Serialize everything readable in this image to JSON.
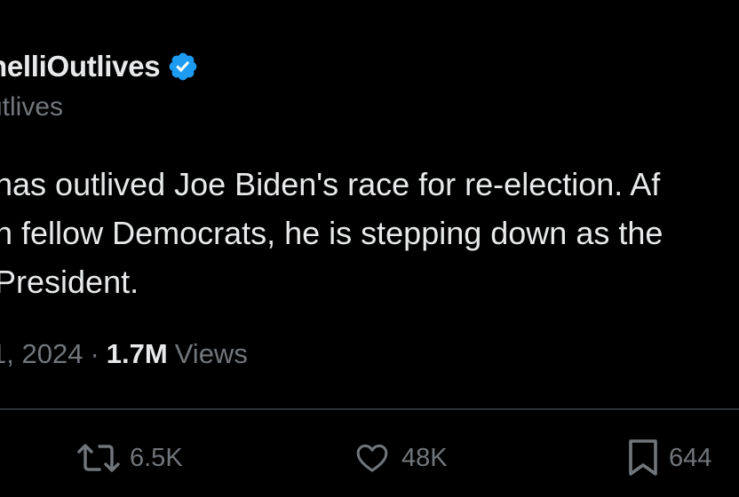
{
  "author": {
    "display_name": "nelliOutlives",
    "handle": "utlives",
    "verified_icon": "verified-badge-icon",
    "verified_color": "#1d9bf0"
  },
  "tweet": {
    "lines": [
      "has outlived Joe Biden's race for re-election. Af",
      "n fellow Democrats, he is stepping down as the",
      "President."
    ]
  },
  "meta": {
    "date": "1, 2024",
    "separator": "·",
    "views_count": "1.7M",
    "views_label": "Views"
  },
  "actions": {
    "retweet": {
      "icon": "retweet-icon",
      "count": "6.5K"
    },
    "like": {
      "icon": "heart-icon",
      "count": "48K"
    },
    "bookmark": {
      "icon": "bookmark-icon",
      "count": "644"
    }
  },
  "colors": {
    "background": "#000000",
    "primary_text": "#e7e9ea",
    "secondary_text": "#71767b",
    "divider": "#2f3336"
  }
}
